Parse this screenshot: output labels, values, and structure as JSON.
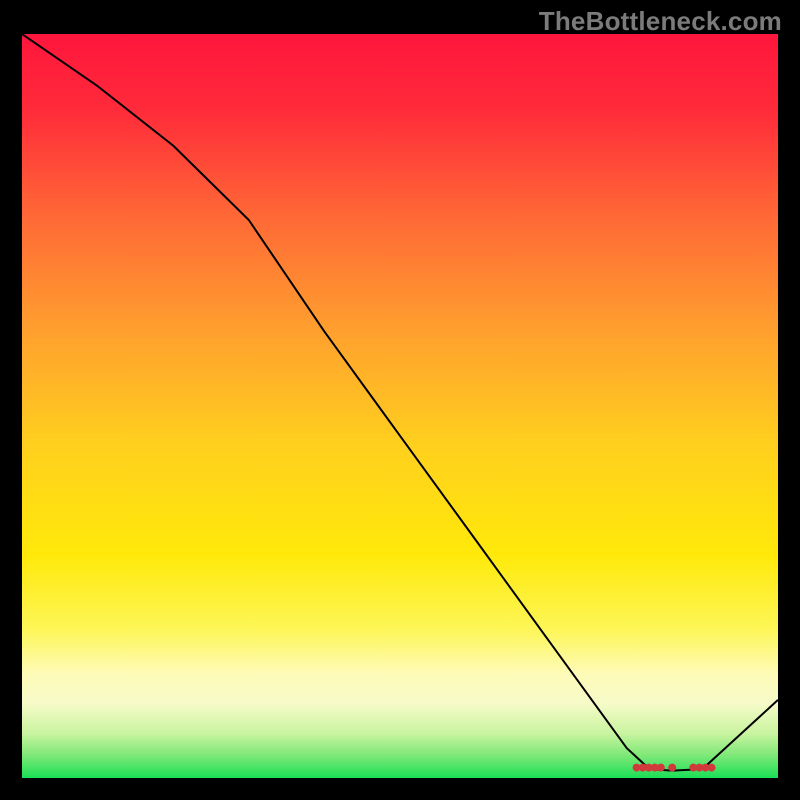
{
  "watermark": "TheBottleneck.com",
  "chart_data": {
    "type": "line",
    "title": "",
    "xlabel": "",
    "ylabel": "",
    "xlim": [
      0,
      100
    ],
    "ylim": [
      0,
      100
    ],
    "grid": false,
    "series": [
      {
        "name": "curve",
        "x": [
          0,
          10,
          20,
          30,
          40,
          50,
          60,
          70,
          80,
          83,
          86,
          90,
          100
        ],
        "y": [
          100,
          93,
          85,
          75,
          60,
          46,
          32,
          18,
          4,
          1.2,
          1.0,
          1.2,
          10.5
        ],
        "stroke": "#000000",
        "stroke_width": 2
      }
    ],
    "markers": {
      "y_baseline": 1.4,
      "xs": [
        81.3,
        82.1,
        82.9,
        83.7,
        84.5,
        86.0,
        88.8,
        89.6,
        90.4,
        91.2
      ],
      "color": "#d03a3a",
      "r": 4
    },
    "gradient_stops": [
      {
        "offset": 0.0,
        "color": "#ff163d"
      },
      {
        "offset": 0.1,
        "color": "#ff2a3a"
      },
      {
        "offset": 0.25,
        "color": "#ff6a36"
      },
      {
        "offset": 0.4,
        "color": "#ffa02e"
      },
      {
        "offset": 0.55,
        "color": "#ffcf1e"
      },
      {
        "offset": 0.7,
        "color": "#ffe90a"
      },
      {
        "offset": 0.8,
        "color": "#fdf657"
      },
      {
        "offset": 0.86,
        "color": "#fefbb8"
      },
      {
        "offset": 0.9,
        "color": "#f6fbc8"
      },
      {
        "offset": 0.94,
        "color": "#c9f4a0"
      },
      {
        "offset": 0.97,
        "color": "#7de877"
      },
      {
        "offset": 1.0,
        "color": "#1adf57"
      }
    ]
  }
}
